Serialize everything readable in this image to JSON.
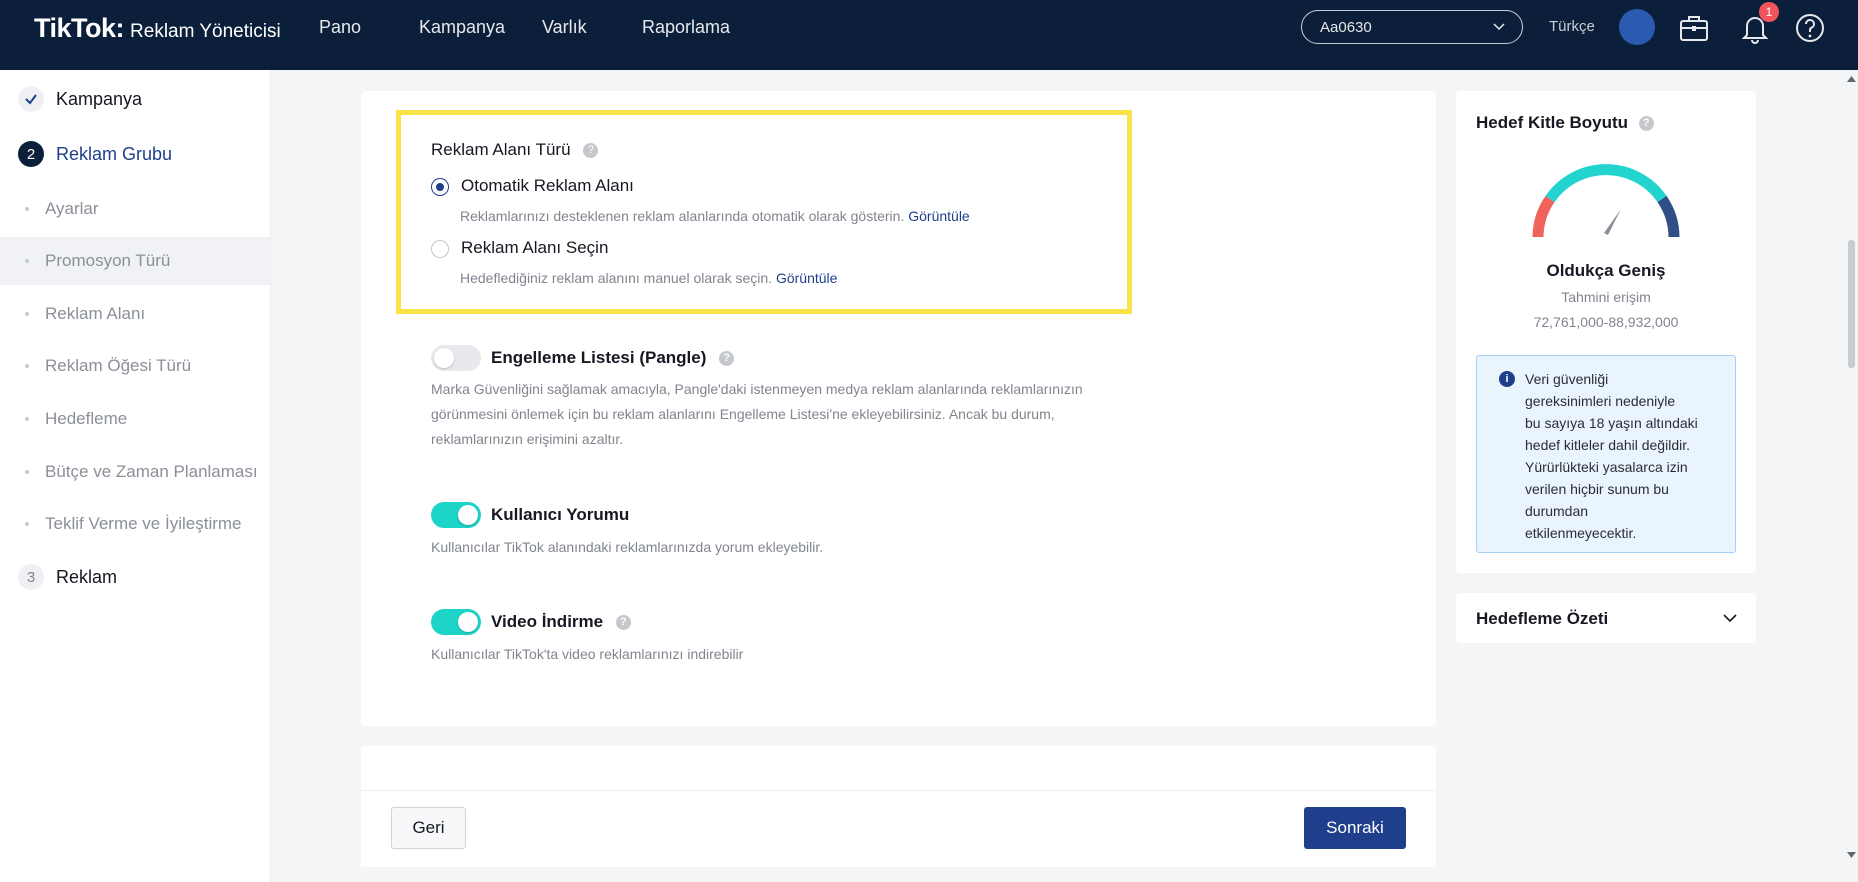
{
  "header": {
    "logo_brand": "TikTok",
    "logo_colon": ":",
    "logo_sub": "Reklam Yöneticisi",
    "nav": [
      "Pano",
      "Kampanya",
      "Varlık",
      "Raporlama"
    ],
    "account": "Aa0630",
    "language": "Türkçe",
    "notification_count": "1"
  },
  "sidebar": {
    "steps": [
      {
        "label": "Kampanya",
        "state": "done"
      },
      {
        "label": "Reklam Grubu",
        "number": "2",
        "state": "active"
      },
      {
        "label": "Reklam",
        "number": "3",
        "state": "pending"
      }
    ],
    "sub_items": [
      "Ayarlar",
      "Promosyon Türü",
      "Reklam Alanı",
      "Reklam Öğesi Türü",
      "Hedefleme",
      "Bütçe ve Zaman Planlaması",
      "Teklif Verme ve İyileştirme"
    ],
    "active_sub_item": "Promosyon Türü"
  },
  "placement": {
    "title": "Reklam Alanı Türü",
    "help": "?",
    "options": [
      {
        "label": "Otomatik Reklam Alanı",
        "desc": "Reklamlarınızı desteklenen reklam alanlarında otomatik olarak gösterin.",
        "link": "Görüntüle",
        "checked": true
      },
      {
        "label": "Reklam Alanı Seçin",
        "desc": "Hedeflediğiniz reklam alanını manuel olarak seçin.",
        "link": "Görüntüle",
        "checked": false
      }
    ]
  },
  "settings": {
    "blocklist": {
      "title": "Engelleme Listesi (Pangle)",
      "on": false,
      "lines": [
        "Marka Güvenliğini sağlamak amacıyla, Pangle'daki istenmeyen medya reklam alanlarında reklamlarınızın",
        "görünmesini önlemek için bu reklam alanlarını Engelleme Listesi'ne ekleyebilirsiniz. Ancak bu durum,",
        "reklamlarınızın erişimini azaltır."
      ]
    },
    "comments": {
      "title": "Kullanıcı Yorumu",
      "on": true,
      "desc": "Kullanıcılar TikTok alanındaki reklamlarınızda yorum ekleyebilir."
    },
    "download": {
      "title": "Video İndirme",
      "on": true,
      "desc": "Kullanıcılar TikTok'ta video reklamlarınızı indirebilir"
    }
  },
  "footer": {
    "back": "Geri",
    "next": "Sonraki"
  },
  "audience": {
    "title": "Hedef Kitle Boyutu",
    "gauge_label": "Oldukça Geniş",
    "reach_label": "Tahmini erişim",
    "reach_range": "72,761,000-88,932,000",
    "info_icon": "i",
    "info_lines": [
      "Veri güvenliği",
      "gereksinimleri nedeniyle",
      "bu sayıya 18 yaşın altındaki",
      "hedef kitleler dahil değildir.",
      "Yürürlükteki yasalarca izin",
      "verilen hiçbir sunum bu",
      "durumdan",
      "etkilenmeyecektir."
    ]
  },
  "targeting_summary": {
    "title": "Hedefleme Özeti"
  },
  "colors": {
    "nav_bg": "#0c1f3a",
    "accent": "#1f3f8c",
    "toggle_on": "#1cd4c8",
    "highlight": "#f8e447"
  }
}
